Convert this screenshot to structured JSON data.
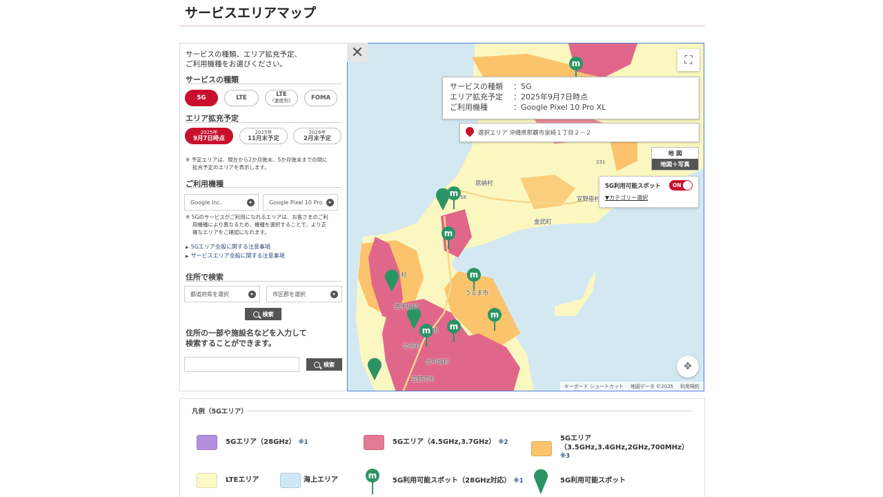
{
  "page_title": "サービスエリアマップ",
  "panel": {
    "intro_line1": "サービスの種類、エリア拡充予定、",
    "intro_line2": "ご利用機種をお選びください。",
    "service_heading": "サービスの種類",
    "service_types": [
      {
        "label": "5G",
        "sub": "",
        "active": true
      },
      {
        "label": "LTE",
        "sub": "",
        "active": false
      },
      {
        "label": "LTE",
        "sub": "(速度別)",
        "active": false
      },
      {
        "label": "FOMA",
        "sub": "",
        "active": false
      }
    ],
    "plan_heading": "エリア拡充予定",
    "plan_options": [
      {
        "top": "2025年",
        "bottom": "9月7日時点",
        "active": true
      },
      {
        "top": "2025年",
        "bottom": "11月末予定",
        "active": false
      },
      {
        "top": "2026年",
        "bottom": "2月末予定",
        "active": false
      }
    ],
    "plan_note_line1": "※ 予定エリアは、現在から2か月後末、5か月後末までの間に",
    "plan_note_line2": "拡充予定のエリアを表示します。",
    "device_heading": "ご利用機種",
    "maker_select": "Google Inc.",
    "model_select": "Google Pixel 10 Pro",
    "device_note_line1": "※ 5Gのサービスがご利用になれるエリアは、お客さまのご利",
    "device_note_line2": "用機種により異なるため、機種を選択することで、より正",
    "device_note_line3": "確なエリアをご確認になれます。",
    "link1": "5Gエリア全般に関する注意事項",
    "link2": "サービスエリア全般に関する注意事項",
    "address_heading": "住所で検索",
    "pref_select": "都道府県を選択",
    "city_select": "市区郡を選択",
    "search_label": "検索",
    "free_note_line1": "住所の一部や施設名などを入力して",
    "free_note_line2": "検索することができます。",
    "free_search_label": "検索",
    "free_input_value": ""
  },
  "map": {
    "close_icon": "close-icon",
    "info": {
      "service_key": "サービスの種類",
      "service_val": "：5G",
      "plan_key": "エリア拡充予定",
      "plan_val": "：2025年9月7日時点",
      "device_key": "ご利用機種",
      "device_val": "：Google Pixel 10 Pro XL"
    },
    "selected_area": "選択エリア  沖縄県那覇市泉崎１丁目２－２",
    "maptype_map": "地 図",
    "maptype_sat": "地図＋写真",
    "spot_label": "5G利用可能スポット",
    "spot_toggle": "ON",
    "category_link": "▼カテゴリー選択",
    "labels": {
      "onna": "恩納村",
      "kin": "金武町",
      "ginoza": "宜野座村",
      "uruma": "うるま市",
      "kadena": "嘉手納町",
      "chatan": "北谷町",
      "kitanakagusuku": "北中城村",
      "yomitan": "村",
      "okinawa": "市",
      "ginowan": "宜野湾市"
    },
    "road_58": "58",
    "road_331": "331",
    "footer_shortcuts": "キーボード ショートカット",
    "footer_data": "地図データ ©2025",
    "footer_terms": "利用規約",
    "colors": {
      "sea": "#d4e8f1",
      "land_lte": "#fbf7c0",
      "area_28": "#b28fdf",
      "area_45": "#e0678a",
      "area_35": "#fbc36c",
      "marker": "#2b9465",
      "brand": "#c8102e"
    }
  },
  "legend": {
    "title": "凡例（5Gエリア）",
    "items": [
      {
        "label": "5Gエリア（28GHz）",
        "ref": "※1",
        "color": "#b28fdf"
      },
      {
        "label": "5Gエリア（4.5GHz,3.7GHz）",
        "ref": "※2",
        "color": "#e47a94"
      },
      {
        "label": "5Gエリア",
        "label2": "（3.5GHz,3.4GHz,2GHz,700MHz）",
        "ref": "※3",
        "color": "#fbc36c"
      },
      {
        "label": "LTEエリア",
        "ref": "",
        "color": "#fdf9c5"
      },
      {
        "label": "海上エリア",
        "ref": "",
        "color": "#cfe8f6"
      },
      {
        "label": "5G利用可能スポット（28GHz対応）",
        "ref": "※1",
        "icon": "m-spot-pin-icon"
      },
      {
        "label": "5G利用可能スポット",
        "ref": "",
        "icon": "spot-pin-icon"
      }
    ]
  }
}
